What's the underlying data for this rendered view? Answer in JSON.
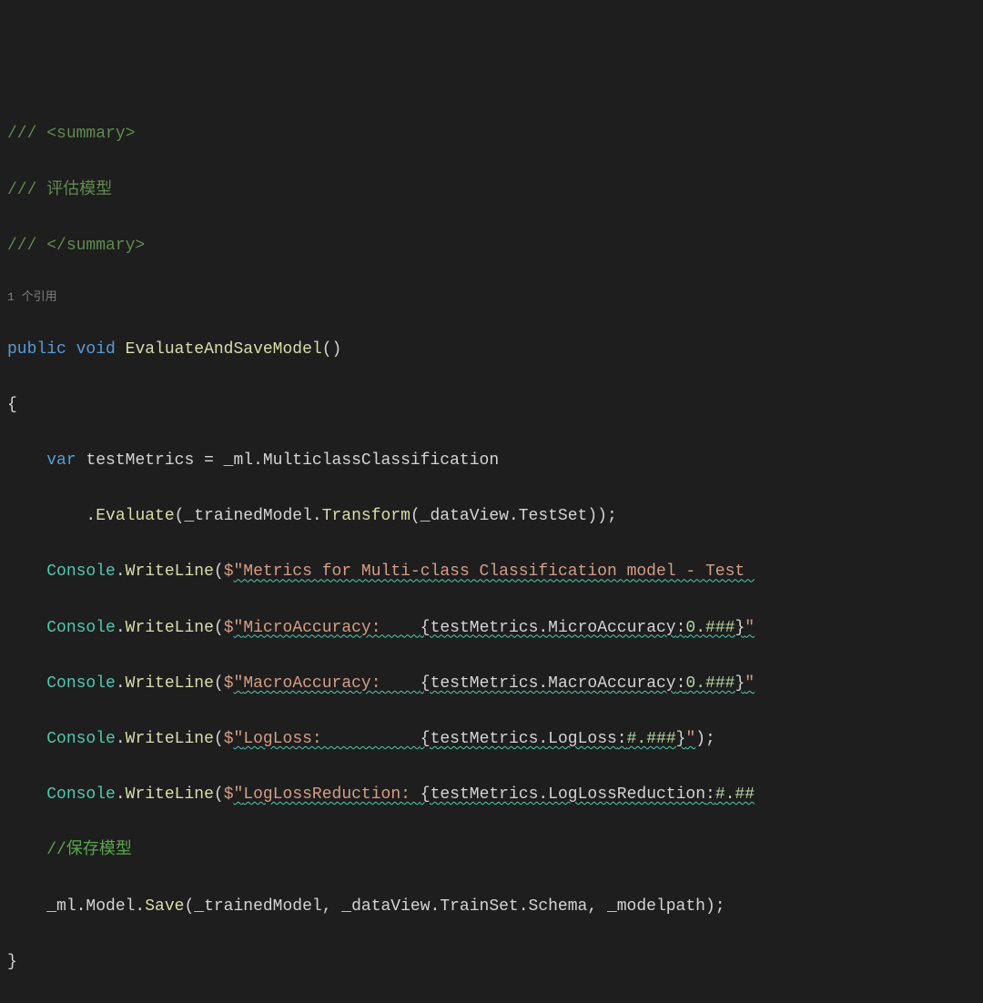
{
  "lines": {
    "l1": {
      "prefix": "/// ",
      "tag": "<summary>"
    },
    "l2": {
      "prefix": "/// ",
      "text": "评估模型"
    },
    "l3": {
      "prefix": "/// ",
      "tag": "</summary>"
    },
    "l4": "1 个引用",
    "l5": {
      "kw1": "public",
      "kw2": "void",
      "method": "EvaluateAndSaveModel",
      "parens": "()"
    },
    "l6": "{",
    "l7": {
      "indent": "    ",
      "kw": "var",
      "var": "testMetrics",
      "eq": " = ",
      "expr": "_ml.MulticlassClassification"
    },
    "l8": {
      "indent": "        ",
      "dot": ".",
      "method": "Evaluate",
      "args": "(_trainedModel.",
      "method2": "Transform",
      "args2": "(_dataView.TestSet));"
    },
    "l9": {
      "indent": "    ",
      "cls": "Console",
      "dot": ".",
      "method": "WriteLine",
      "open": "(",
      "dollar": "$",
      "str": "\"Metrics for Multi-class Classification model - Test "
    },
    "l10": {
      "indent": "    ",
      "cls": "Console",
      "dot": ".",
      "method": "WriteLine",
      "open": "(",
      "dollar": "$",
      "qopen": "\"",
      "label": "MicroAccuracy:    ",
      "interp_open": "{",
      "interp_expr": "testMetrics.MicroAccuracy",
      "colon": ":",
      "fmt": "0.###",
      "interp_close": "}",
      "qclose": "\""
    },
    "l11": {
      "indent": "    ",
      "cls": "Console",
      "dot": ".",
      "method": "WriteLine",
      "open": "(",
      "dollar": "$",
      "qopen": "\"",
      "label": "MacroAccuracy:    ",
      "interp_open": "{",
      "interp_expr": "testMetrics.MacroAccuracy",
      "colon": ":",
      "fmt": "0.###",
      "interp_close": "}",
      "qclose": "\""
    },
    "l12": {
      "indent": "    ",
      "cls": "Console",
      "dot": ".",
      "method": "WriteLine",
      "open": "(",
      "dollar": "$",
      "qopen": "\"",
      "label": "LogLoss:          ",
      "interp_open": "{",
      "interp_expr": "testMetrics.LogLoss",
      "colon": ":",
      "fmt": "#.###",
      "interp_close": "}",
      "qclose": "\"",
      "close": ");"
    },
    "l13": {
      "indent": "    ",
      "cls": "Console",
      "dot": ".",
      "method": "WriteLine",
      "open": "(",
      "dollar": "$",
      "qopen": "\"",
      "label": "LogLossReduction: ",
      "interp_open": "{",
      "interp_expr": "testMetrics.LogLossReduction",
      "colon": ":",
      "fmt": "#.##"
    },
    "l14": {
      "indent": "    ",
      "text": "//保存模型"
    },
    "l15": {
      "indent": "    ",
      "expr1": "_ml.Model.",
      "method": "Save",
      "args": "(_trainedModel, _dataView.TrainSet.Schema, _modelpath);"
    },
    "l16": "}"
  }
}
